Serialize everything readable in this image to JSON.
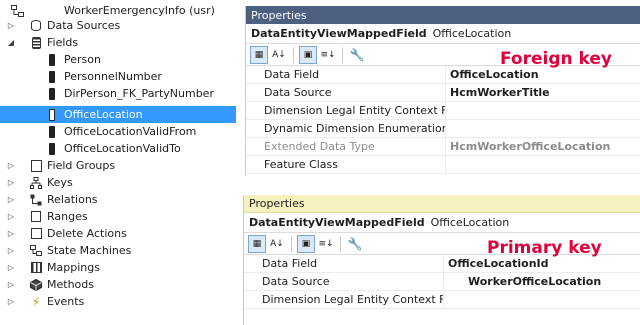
{
  "tree": {
    "root": "WorkerEmergencyInfo (usr)",
    "items": [
      {
        "label": "Data Sources",
        "arrow": "▷",
        "icon": "database-icon"
      },
      {
        "label": "Fields",
        "arrow": "◢",
        "icon": "fields-icon"
      },
      {
        "label": "Person",
        "icon": "field-icon"
      },
      {
        "label": "PersonnelNumber",
        "icon": "field-icon"
      },
      {
        "label": "DirPerson_FK_PartyNumber",
        "icon": "field-icon"
      },
      {
        "label": "OfficeLocation",
        "icon": "field-icon",
        "selected": true
      },
      {
        "label": "OfficeLocationValidFrom",
        "icon": "field-icon"
      },
      {
        "label": "OfficeLocationValidTo",
        "icon": "field-icon"
      },
      {
        "label": "Field Groups",
        "arrow": "▷",
        "icon": "field-groups-icon"
      },
      {
        "label": "Keys",
        "arrow": "▷",
        "icon": "keys-icon"
      },
      {
        "label": "Relations",
        "arrow": "▷",
        "icon": "relations-icon"
      },
      {
        "label": "Ranges",
        "arrow": "▷",
        "icon": "ranges-icon"
      },
      {
        "label": "Delete Actions",
        "arrow": "▷",
        "icon": "delete-actions-icon"
      },
      {
        "label": "State Machines",
        "arrow": "▷",
        "icon": "state-machines-icon"
      },
      {
        "label": "Mappings",
        "arrow": "▷",
        "icon": "mappings-icon"
      },
      {
        "label": "Methods",
        "arrow": "▷",
        "icon": "methods-icon"
      },
      {
        "label": "Events",
        "arrow": "▷",
        "icon": "events-icon"
      }
    ]
  },
  "props1": {
    "title": "Properties",
    "type": "DataEntityViewMappedField",
    "name": "OfficeLocation",
    "callout": "Foreign key",
    "rows": [
      {
        "name": "Data Field",
        "value": "OfficeLocation"
      },
      {
        "name": "Data Source",
        "value": "HcmWorkerTitle"
      },
      {
        "name": "Dimension Legal Entity Context Field",
        "value": ""
      },
      {
        "name": "Dynamic Dimension Enumeration Field",
        "value": ""
      },
      {
        "name": "Extended Data Type",
        "value": "HcmWorkerOfficeLocation",
        "dim": true
      },
      {
        "name": "Feature Class",
        "value": ""
      }
    ]
  },
  "props2": {
    "title": "Properties",
    "type": "DataEntityViewMappedField",
    "name": "OfficeLocation",
    "callout": "Primary key",
    "rows": [
      {
        "name": "Data Field",
        "value": "OfficeLocationId"
      },
      {
        "name": "Data Source",
        "value": "WorkerOfficeLocation"
      },
      {
        "name": "Dimension Legal Entity Context Field",
        "value": ""
      }
    ]
  },
  "colors": {
    "selection": "#3399ff",
    "props_title_dark": "#4d6082",
    "props_title_light": "#f5f2c0",
    "callout": "#e0003c"
  }
}
